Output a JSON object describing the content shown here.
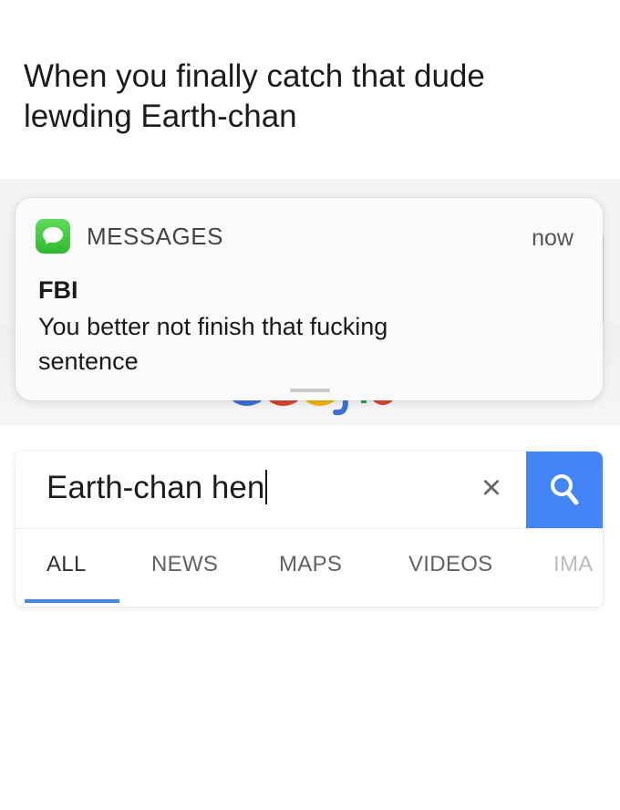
{
  "caption": {
    "line1": "When you finally catch that dude",
    "line2": "lewding Earth-chan"
  },
  "notification": {
    "app_icon": "messages-icon",
    "app_name": "MESSAGES",
    "time": "now",
    "sender": "FBI",
    "message_line1": "You better not finish that fucking",
    "message_line2": "sentence"
  },
  "search": {
    "query": "Earth-chan hen",
    "clear_icon": "close-icon",
    "clear_symbol": "×",
    "search_icon": "search-icon",
    "accent_color": "#4385f4"
  },
  "tabs": [
    {
      "label": "ALL",
      "active": true
    },
    {
      "label": "NEWS",
      "active": false
    },
    {
      "label": "MAPS",
      "active": false
    },
    {
      "label": "VIDEOS",
      "active": false
    },
    {
      "label": "IMA",
      "active": false
    }
  ],
  "colors": {
    "messages_green": "#34c234",
    "google_blue": "#4385f4"
  }
}
